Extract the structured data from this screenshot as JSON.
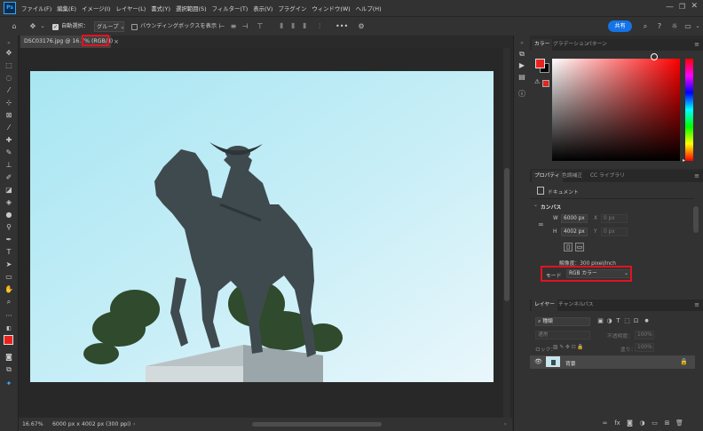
{
  "app": {
    "logo_text": "Ps",
    "menu": [
      "ファイル(F)",
      "編集(E)",
      "イメージ(I)",
      "レイヤー(L)",
      "書式(Y)",
      "選択範囲(S)",
      "フィルター(T)",
      "表示(V)",
      "プラグイン",
      "ウィンドウ(W)",
      "ヘルプ(H)"
    ]
  },
  "options_bar": {
    "auto_select_label": "自動選択：",
    "auto_select_checked": true,
    "group_value": "グループ",
    "show_transform_label": "バウンディングボックスを表示",
    "show_transform_checked": false,
    "more_label": "•••",
    "share_label": "共有"
  },
  "document": {
    "tab_title": "DSC03176.jpg @ 16.7%",
    "tab_mode": "(RGB/8)",
    "zoom": "16.67%",
    "info": "6000 px x 4002 px (300 ppi)"
  },
  "color_panel": {
    "tabs": [
      "カラー",
      "グラデーション",
      "パターン"
    ],
    "foreground": "#e8231f",
    "background": "#000000",
    "hue_color": "#ff0000"
  },
  "properties_panel": {
    "tabs": [
      "プロパティ",
      "色調補正",
      "CC ライブラリ"
    ],
    "doc_label": "ドキュメント",
    "canvas_title": "カンバス",
    "w_label": "W",
    "w_value": "6000 px",
    "h_label": "H",
    "h_value": "4002 px",
    "x_label": "X",
    "x_value": "0 px",
    "y_label": "Y",
    "y_value": "0 px",
    "resolution": "解像度：300 pixel/inch",
    "mode_label": "モード",
    "mode_value": "RGB カラー"
  },
  "layers_panel": {
    "tabs": [
      "レイヤー",
      "チャンネル",
      "パス"
    ],
    "search_placeholder": "種類",
    "blend_mode": "通常",
    "opacity_label": "不透明度：",
    "opacity_value": "100%",
    "lock_label": "ロック：",
    "fill_label": "塗り：",
    "fill_value": "100%",
    "layer_name": "背景"
  }
}
